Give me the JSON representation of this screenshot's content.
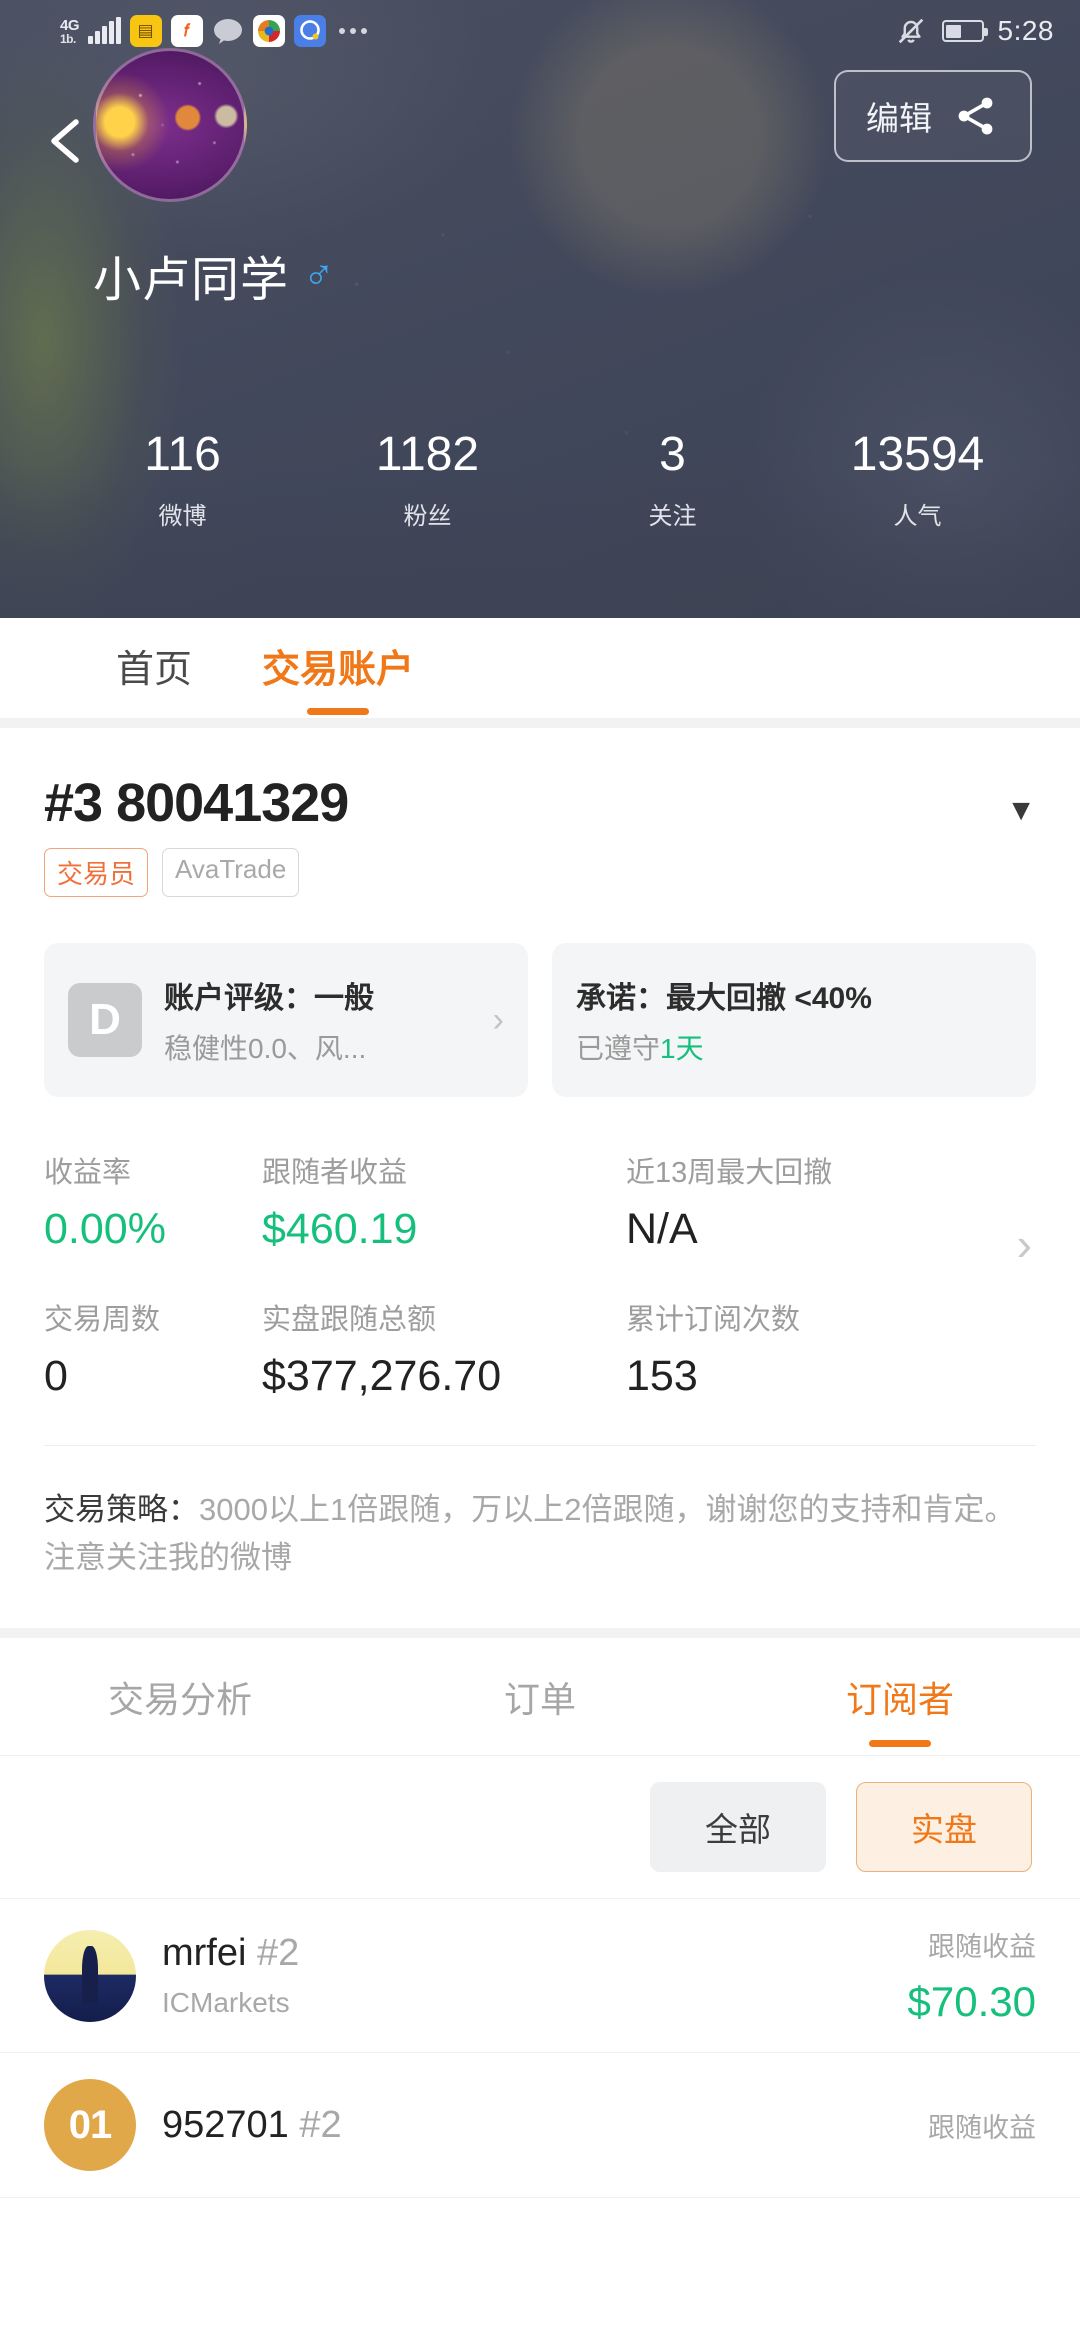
{
  "statusbar": {
    "network": "4G",
    "network_sub": "1b.",
    "time": "5:28",
    "icons": [
      "signal-bars-icon",
      "yellow-doc-app-icon",
      "orange-f-app-icon",
      "chat-bubble-app-icon",
      "multicolor-app-icon",
      "blue-q-app-icon",
      "overflow-dots-icon"
    ],
    "right_icons": [
      "bell-muted-icon",
      "battery-icon"
    ]
  },
  "profile": {
    "back_label": "",
    "edit_label": "编辑",
    "username": "小卢同学",
    "gender_symbol": "♂",
    "stats": [
      {
        "value": "116",
        "label": "微博"
      },
      {
        "value": "1182",
        "label": "粉丝"
      },
      {
        "value": "3",
        "label": "关注"
      },
      {
        "value": "13594",
        "label": "人气"
      }
    ]
  },
  "top_tabs": [
    {
      "label": "首页",
      "active": false
    },
    {
      "label": "交易账户",
      "active": true
    }
  ],
  "account": {
    "number": "#3 80041329",
    "badges": [
      {
        "text": "交易员",
        "style": "orange"
      },
      {
        "text": "AvaTrade",
        "style": "gray"
      }
    ],
    "rating_card": {
      "grade": "D",
      "title": "账户评级：一般",
      "subtitle": "稳健性0.0、风..."
    },
    "promise_card": {
      "title": "承诺：最大回撤 <40%",
      "sub_prefix": "已遵守",
      "sub_value": "1天"
    },
    "metrics_row1": [
      {
        "label": "收益率",
        "value": "0.00%",
        "color": "green"
      },
      {
        "label": "跟随者收益",
        "value": "$460.19",
        "color": "green"
      },
      {
        "label": "近13周最大回撤",
        "value": "N/A",
        "color": "dark"
      }
    ],
    "metrics_row2": [
      {
        "label": "交易周数",
        "value": "0",
        "color": "dark"
      },
      {
        "label": "实盘跟随总额",
        "value": "$377,276.70",
        "color": "dark"
      },
      {
        "label": "累计订阅次数",
        "value": "153",
        "color": "dark"
      }
    ],
    "strategy_label": "交易策略：",
    "strategy_text": "3000以上1倍跟随，万以上2倍跟随，谢谢您的支持和肯定。注意关注我的微博"
  },
  "lower_tabs": [
    {
      "label": "交易分析",
      "active": false
    },
    {
      "label": "订单",
      "active": false
    },
    {
      "label": "订阅者",
      "active": true
    }
  ],
  "filters": [
    {
      "label": "全部",
      "active": false
    },
    {
      "label": "实盘",
      "active": true
    }
  ],
  "subscribers": [
    {
      "avatar": "knight",
      "name": "mrfei",
      "rank": "#2",
      "broker": "ICMarkets",
      "profit_label": "跟随收益",
      "profit_value": "$70.30"
    },
    {
      "avatar": "01",
      "avatar_text": "01",
      "name": "952701",
      "rank": "#2",
      "broker": "",
      "profit_label": "跟随收益",
      "profit_value": ""
    }
  ],
  "colors": {
    "accent_orange": "#f07818",
    "profit_green": "#16c07c",
    "header_dark": "#474d5e"
  }
}
